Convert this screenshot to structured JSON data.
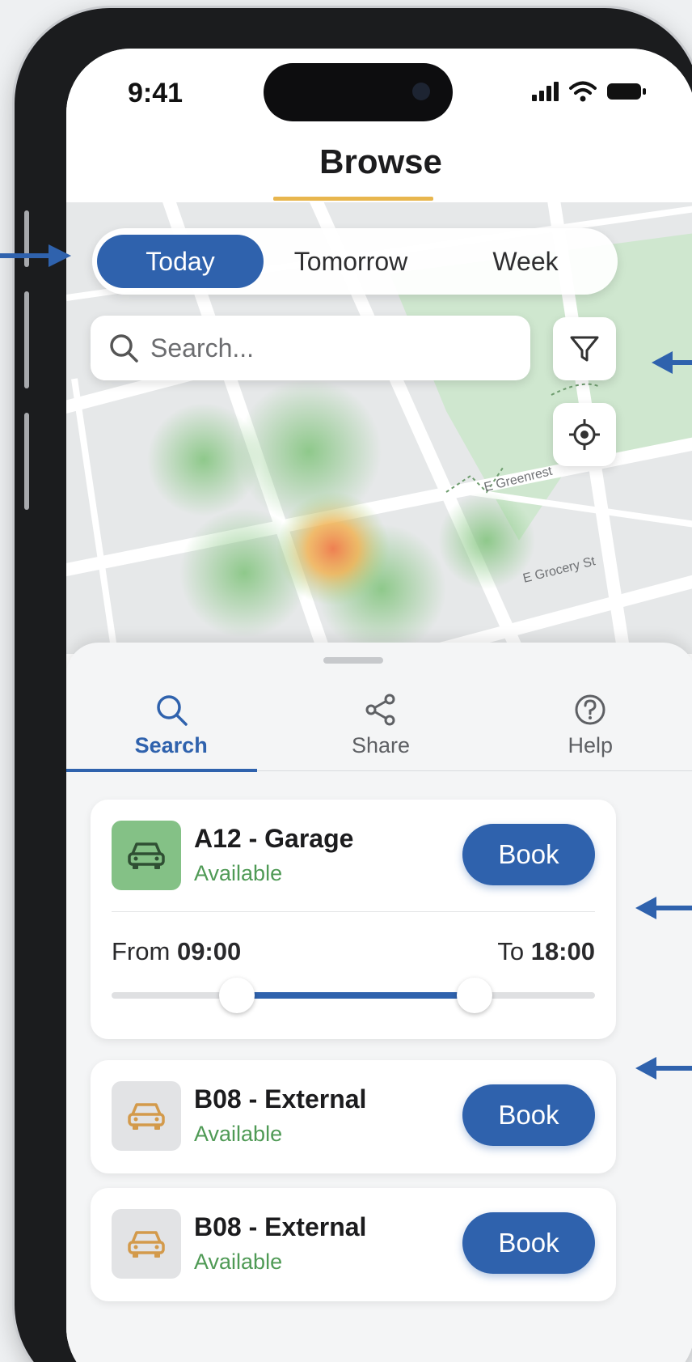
{
  "status_bar": {
    "time": "9:41"
  },
  "header": {
    "title": "Browse"
  },
  "segments": [
    {
      "label": "Today",
      "active": true
    },
    {
      "label": "Tomorrow",
      "active": false
    },
    {
      "label": "Week",
      "active": false
    }
  ],
  "search": {
    "placeholder": "Search..."
  },
  "map": {
    "street_labels": [
      "E Greenrest",
      "E Grocery St"
    ]
  },
  "bottom_tabs": [
    {
      "label": "Search",
      "icon": "search-icon",
      "active": true
    },
    {
      "label": "Share",
      "icon": "share-icon",
      "active": false
    },
    {
      "label": "Help",
      "icon": "help-icon",
      "active": false
    }
  ],
  "spots": [
    {
      "name": "A12 - Garage",
      "status": "Available",
      "book_label": "Book",
      "icon_color": "#84c186",
      "time_from_label": "From",
      "time_from": "09:00",
      "time_to_label": "To",
      "time_to": "18:00",
      "range_start_fraction": 0.26,
      "range_end_fraction": 0.75
    },
    {
      "name": "B08 - External",
      "status": "Available",
      "book_label": "Book",
      "icon_color": "#e2e3e5"
    },
    {
      "name": "B08 - External",
      "status": "Available",
      "book_label": "Book",
      "icon_color": "#e2e3e5"
    }
  ],
  "colors": {
    "accent": "#2f62ad",
    "available": "#4f9a55",
    "title_underline": "#e8b64e",
    "car_icon_orange": "#d39a4b"
  }
}
